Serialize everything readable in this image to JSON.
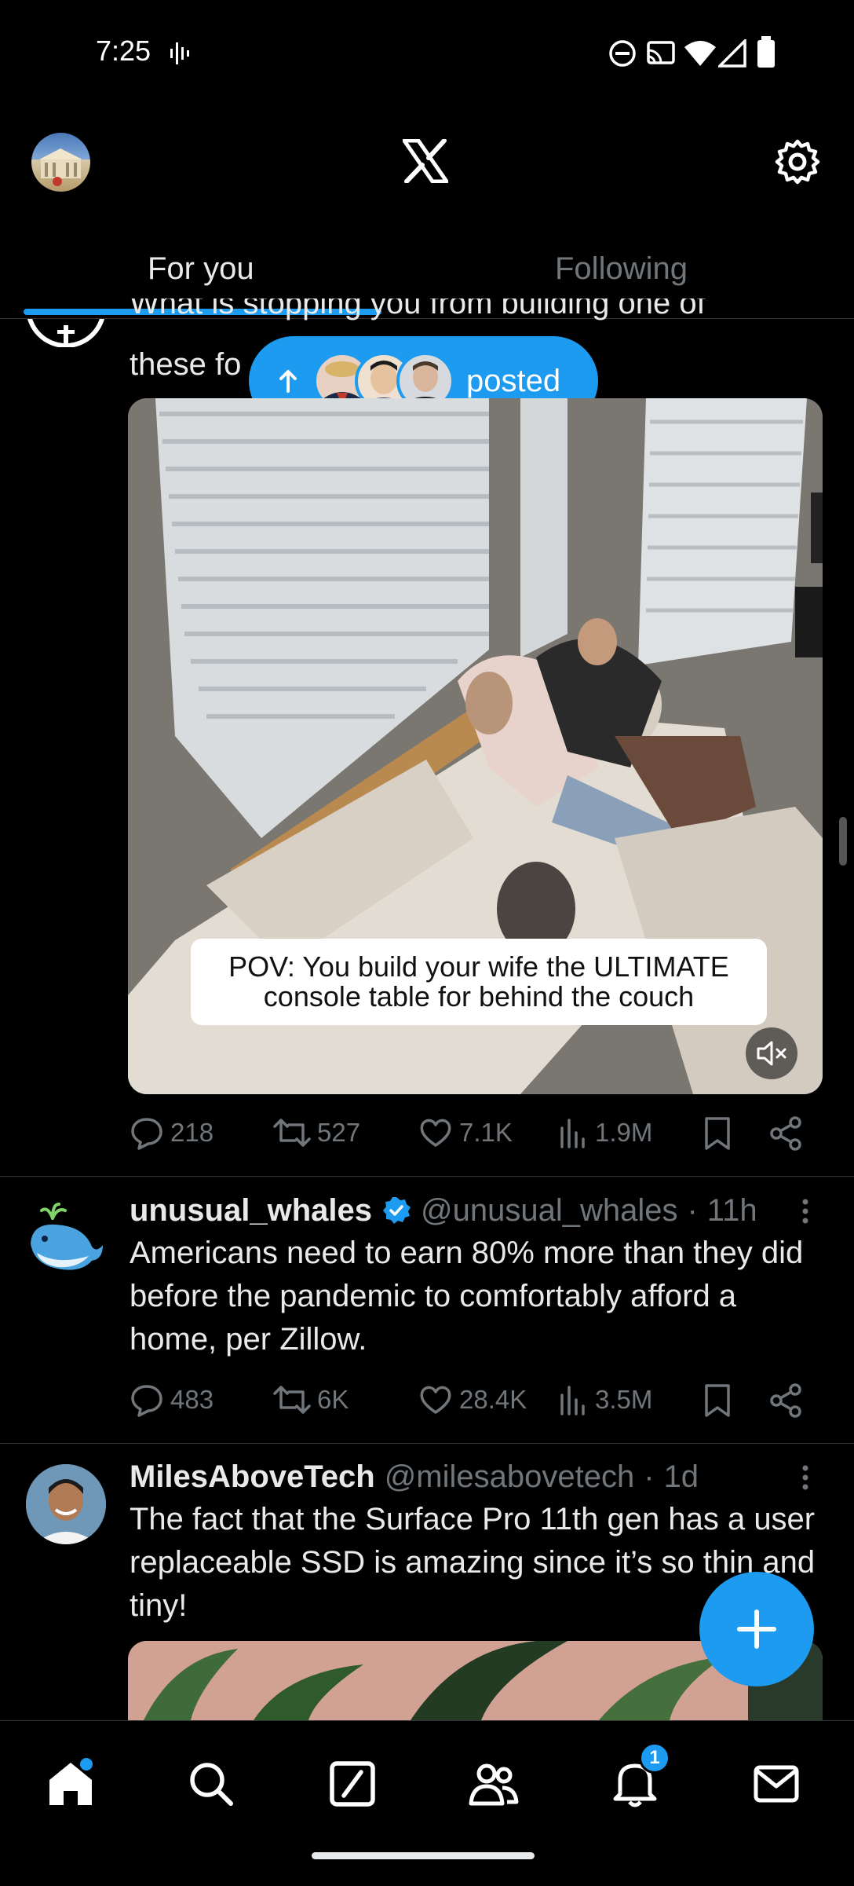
{
  "status_bar": {
    "time": "7:25"
  },
  "topbar": {
    "logo": "X"
  },
  "tabs": [
    {
      "label": "For you"
    },
    {
      "label": "Following"
    }
  ],
  "new_posts_pill": {
    "label": "posted"
  },
  "tweet1": {
    "text_line1": "What is stopping you from building one of",
    "text_line2_prefix": "these fo",
    "video_caption": "POV: You build your wife the ULTIMATE console table for behind the couch",
    "metrics": {
      "replies": "218",
      "reposts": "527",
      "likes": "7.1K",
      "views": "1.9M"
    }
  },
  "tweet2": {
    "name": "unusual_whales",
    "handle": "@unusual_whales",
    "time": "11h",
    "text": "Americans need to earn 80% more than they did before the pandemic to comfortably afford a home, per Zillow.",
    "metrics": {
      "replies": "483",
      "reposts": "6K",
      "likes": "28.4K",
      "views": "3.5M"
    }
  },
  "tweet3": {
    "name": "MilesAboveTech",
    "handle": "@milesabovetech",
    "time": "1d",
    "text": "The fact that the Surface Pro 11th gen has a user replaceable SSD is amazing since it’s so thin and tiny!"
  },
  "navbar": {
    "notifications_badge": "1"
  },
  "colors": {
    "accent": "#1d9bf0",
    "background": "#000000",
    "muted": "#71767b"
  }
}
